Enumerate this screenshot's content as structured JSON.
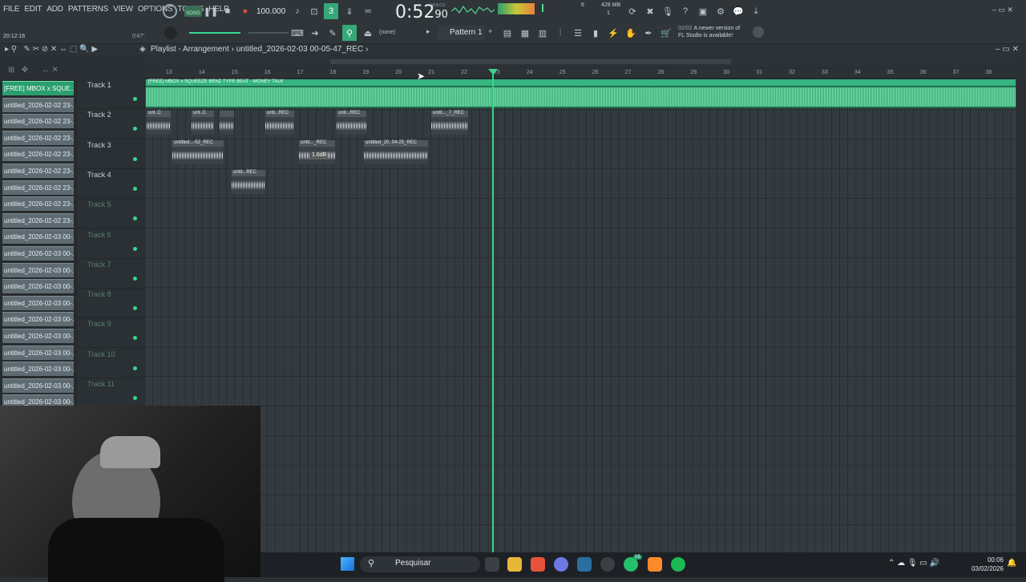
{
  "menu": [
    "FILE",
    "EDIT",
    "ADD",
    "PATTERNS",
    "VIEW",
    "OPTIONS",
    "TOOLS",
    "HELP"
  ],
  "transport": {
    "mode": "SONG",
    "tempo": "100.000",
    "time": "0:52",
    "time_ms": "90",
    "time_label": "M:S:CS",
    "memory": "428 MB",
    "cpu": "6",
    "voices": "1",
    "clock": "20:12:16",
    "position_hint": "0'47\""
  },
  "pattern": {
    "name": "Pattern 1",
    "snap": "(none)"
  },
  "news": {
    "count": "02/02",
    "line1": "A newer version of",
    "line2": "FL Studio is available!"
  },
  "playlist": {
    "title": "Playlist - Arrangement",
    "file": "untitled_2026-02-03 00-05-47_REC"
  },
  "ruler": [
    "13",
    "14",
    "15",
    "16",
    "17",
    "18",
    "19",
    "20",
    "21",
    "22",
    "23",
    "24",
    "25",
    "26",
    "27",
    "28",
    "29",
    "30",
    "31",
    "32",
    "33",
    "34",
    "35",
    "36",
    "37",
    "38"
  ],
  "picker": [
    "[FREE] MBOX x SQUE...",
    "untitled_2026-02-02 23-...",
    "untitled_2026-02-02 23-...",
    "untitled_2026-02-02 23-...",
    "untitled_2026-02-02 23-...",
    "untitled_2026-02-02 23-...",
    "untitled_2026-02-02 23-...",
    "untitled_2026-02-02 23-...",
    "untitled_2026-02-02 23-...",
    "untitled_2026-02-03 00-...",
    "untitled_2026-02-03 00-...",
    "untitled_2026-02-03 00-...",
    "untitled_2026-02-03 00-...",
    "untitled_2026-02-03 00-...",
    "untitled_2026-02-03 00-...",
    "untitled_2026-02-03 00-...",
    "untitled_2026-02-03 00-...",
    "untitled_2026-02-03 00-...",
    "untitled_2026-02-03 00-...",
    "untitled_2026-02-03 00-..."
  ],
  "tracks": [
    "Track 1",
    "Track 2",
    "Track 3",
    "Track 4",
    "Track 5",
    "Track 6",
    "Track 7",
    "Track 8",
    "Track 9",
    "Track 10",
    "Track 11"
  ],
  "clips": {
    "master": "[FREE] MBOX x SQUEEZE BENZ TYPE BEAT - MONEY TALK",
    "t2": [
      "unt..C",
      "unt..C",
      "",
      "unti...REC",
      "unti...REC",
      "untit..._7_REC"
    ],
    "t3": [
      "untitled...-52_REC",
      "untit..._REC",
      "untitled_20..04-25_REC"
    ],
    "t3_gain": "1.6dB",
    "t4": [
      "untit...REC"
    ]
  },
  "taskbar": {
    "search": "Pesquisar",
    "time": "00:06",
    "date": "03/02/2026",
    "badge": "15"
  }
}
